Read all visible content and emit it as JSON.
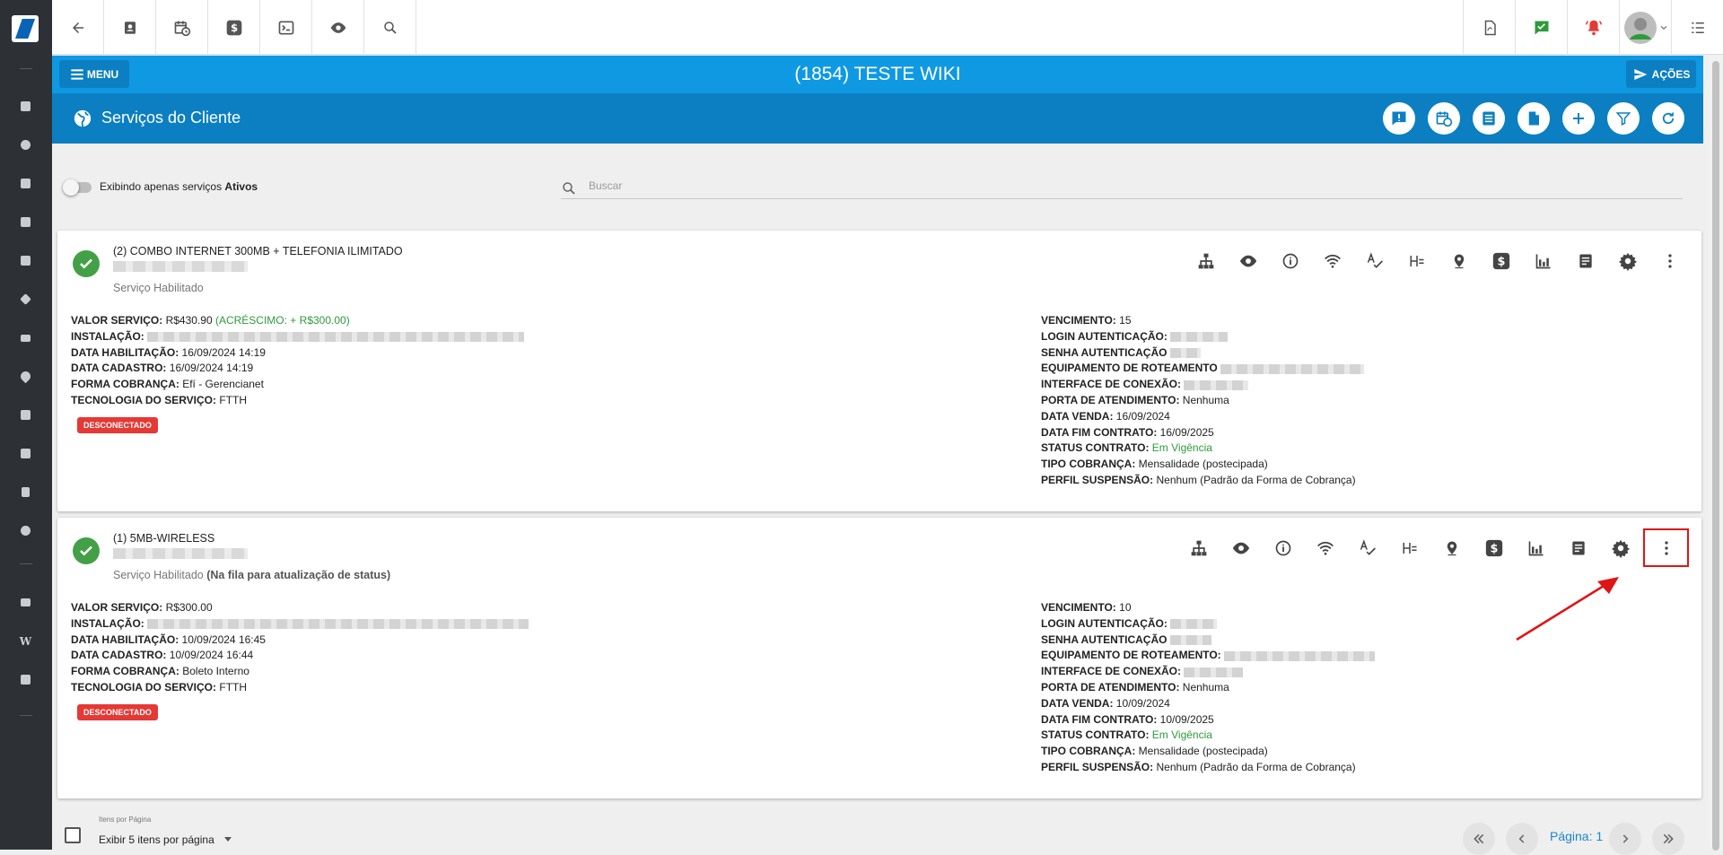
{
  "header": {
    "client_title": "(1854) TESTE WIKI",
    "menu_label": "MENU",
    "actions_label": "AÇÕES"
  },
  "page": {
    "title": "Serviços do Cliente"
  },
  "filter": {
    "toggle_text": "Exibindo apenas serviços ",
    "toggle_bold": "Ativos",
    "search_placeholder": "Buscar"
  },
  "services": [
    {
      "name": "(2) COMBO INTERNET 300MB + TELEFONIA ILIMITADO",
      "status": "Serviço Habilitado",
      "status_note": "",
      "left": {
        "valor_label": "VALOR SERVIÇO:",
        "valor": "R$430.90",
        "acrescimo": "(ACRÉSCIMO: + R$300.00)",
        "instalacao_label": "INSTALAÇÃO:",
        "data_hab_label": "DATA HABILITAÇÃO:",
        "data_hab": "16/09/2024 14:19",
        "data_cad_label": "DATA CADASTRO:",
        "data_cad": "16/09/2024 14:19",
        "forma_label": "FORMA COBRANÇA:",
        "forma": "Efí - Gerencianet",
        "tecnologia_label": "TECNOLOGIA DO SERVIÇO:",
        "tecnologia": "FTTH"
      },
      "badge": "DESCONECTADO",
      "right": {
        "venc_label": "VENCIMENTO:",
        "venc": "15",
        "login_label": "LOGIN AUTENTICAÇÃO:",
        "senha_label": "SENHA AUTENTICAÇÃO",
        "equip_label": "EQUIPAMENTO DE ROTEAMENTO",
        "interface_label": "INTERFACE DE CONEXÃO:",
        "porta_label": "PORTA DE ATENDIMENTO:",
        "porta": "Nenhuma",
        "venda_label": "DATA VENDA:",
        "venda": "16/09/2024",
        "fim_label": "DATA FIM CONTRATO:",
        "fim": "16/09/2025",
        "status_label": "STATUS CONTRATO:",
        "status": "Em Vigência",
        "tipo_label": "TIPO COBRANÇA:",
        "tipo": "Mensalidade (postecipada)",
        "perfil_label": "PERFIL SUSPENSÃO:",
        "perfil": "Nenhum (Padrão da Forma de Cobrança)"
      }
    },
    {
      "name": "(1) 5MB-WIRELESS",
      "status": "Serviço Habilitado",
      "status_note": "(Na fila para atualização de status)",
      "left": {
        "valor_label": "VALOR SERVIÇO:",
        "valor": "R$300.00",
        "acrescimo": "",
        "instalacao_label": "INSTALAÇÃO:",
        "data_hab_label": "DATA HABILITAÇÃO:",
        "data_hab": "10/09/2024 16:45",
        "data_cad_label": "DATA CADASTRO:",
        "data_cad": "10/09/2024 16:44",
        "forma_label": "FORMA COBRANÇA:",
        "forma": "Boleto Interno",
        "tecnologia_label": "TECNOLOGIA DO SERVIÇO:",
        "tecnologia": "FTTH"
      },
      "badge": "DESCONECTADO",
      "right": {
        "venc_label": "VENCIMENTO:",
        "venc": "10",
        "login_label": "LOGIN AUTENTICAÇÃO:",
        "senha_label": "SENHA AUTENTICAÇÃO",
        "equip_label": "EQUIPAMENTO DE ROTEAMENTO:",
        "interface_label": "INTERFACE DE CONEXÃO:",
        "porta_label": "PORTA DE ATENDIMENTO:",
        "porta": "Nenhuma",
        "venda_label": "DATA VENDA:",
        "venda": "10/09/2024",
        "fim_label": "DATA FIM CONTRATO:",
        "fim": "10/09/2025",
        "status_label": "STATUS CONTRATO:",
        "status": "Em Vigência",
        "tipo_label": "TIPO COBRANÇA:",
        "tipo": "Mensalidade (postecipada)",
        "perfil_label": "PERFIL SUSPENSÃO:",
        "perfil": "Nenhum (Padrão da Forma de Cobrança)"
      }
    }
  ],
  "action_icons": [
    "sitemap-icon",
    "eye-icon",
    "info-icon",
    "wifi-icon",
    "spellcheck-icon",
    "h-equals-icon",
    "map-pin-icon",
    "dollar-icon",
    "bar-chart-icon",
    "document-icon",
    "gear-icon",
    "more-vertical-icon"
  ],
  "footer": {
    "items_per_page_label": "Itens por Página",
    "items_per_page_value": "Exibir 5 itens por página",
    "page_label": "Página: 1"
  },
  "colors": {
    "sidebar": "#2d3136",
    "primary": "#0f99e3",
    "primary_dark": "#0c7fc2",
    "success": "#43a047",
    "danger": "#e53935",
    "highlight": "#e01414"
  }
}
